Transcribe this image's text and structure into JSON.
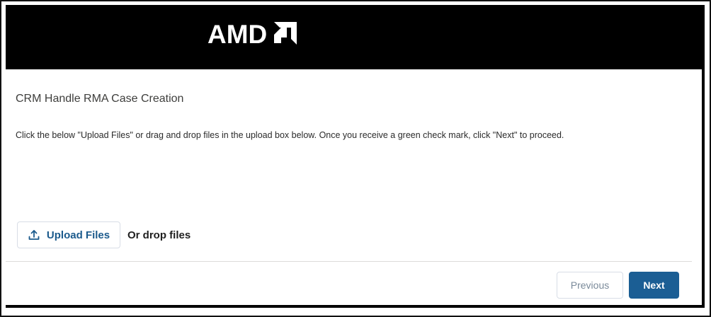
{
  "header": {
    "logo_text": "AMD",
    "logo_icon": "amd-arrow-logo",
    "background_color": "#000000"
  },
  "main": {
    "title": "CRM Handle RMA Case Creation",
    "instructions": "Click the below \"Upload Files\" or drag and drop files in the upload box below. Once you receive a green check mark, click \"Next\" to proceed."
  },
  "upload": {
    "button_label": "Upload Files",
    "button_icon": "upload-icon",
    "drop_label": "Or drop files"
  },
  "footer": {
    "previous_label": "Previous",
    "next_label": "Next"
  },
  "colors": {
    "accent": "#1b5e94",
    "link_text": "#1b5a8c"
  }
}
